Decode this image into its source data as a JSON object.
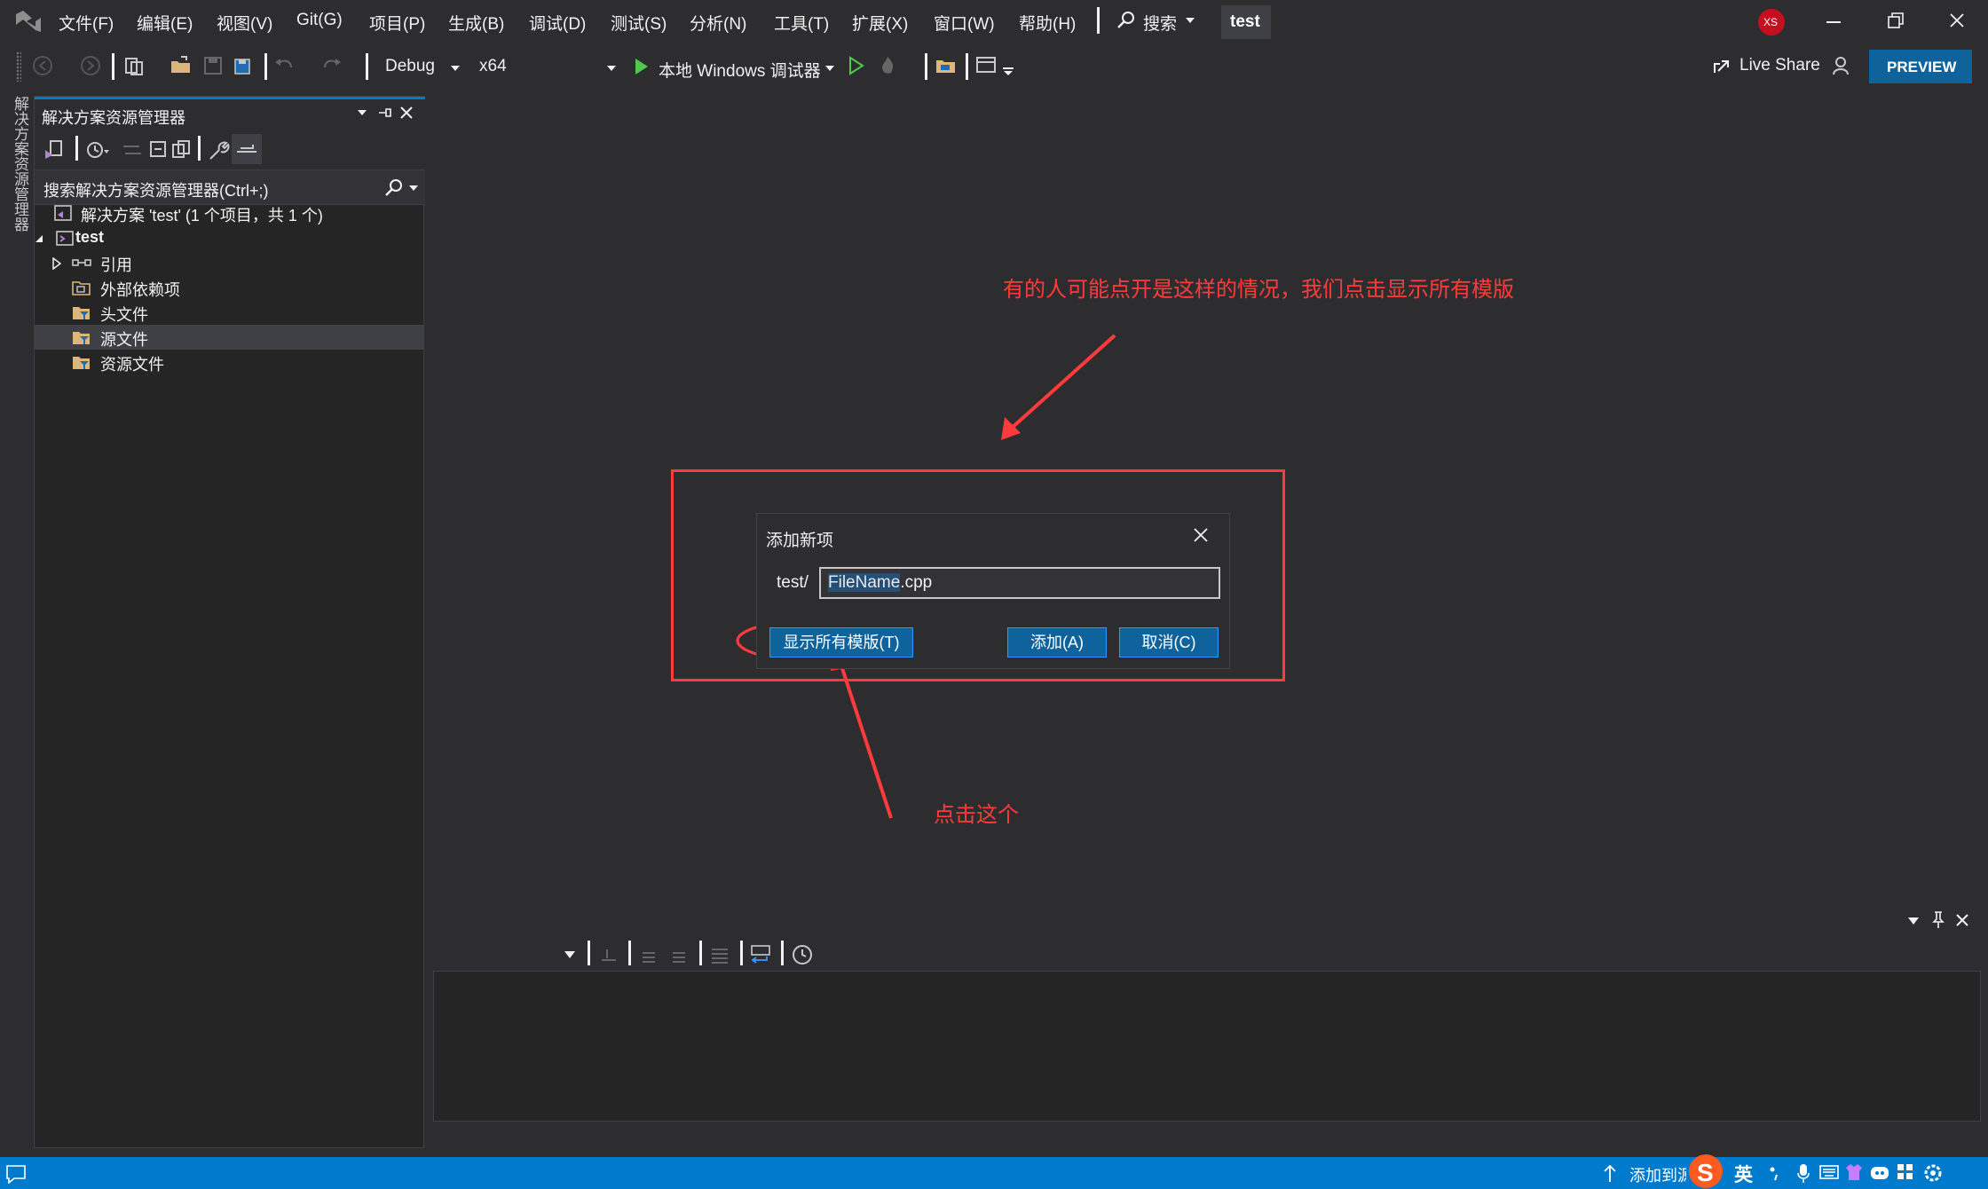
{
  "titlebar": {
    "menus": [
      "文件(F)",
      "编辑(E)",
      "视图(V)",
      "Git(G)",
      "项目(P)",
      "生成(B)",
      "调试(D)",
      "测试(S)",
      "分析(N)",
      "工具(T)",
      "扩展(X)",
      "窗口(W)",
      "帮助(H)"
    ],
    "search_label": "搜索",
    "project_badge": "test",
    "avatar_initials": "XS"
  },
  "toolbar": {
    "configuration": "Debug",
    "platform": "x64",
    "debugger_label": "本地 Windows 调试器",
    "live_share": "Live Share",
    "preview": "PREVIEW"
  },
  "side_strip": {
    "label": "解决方案资源管理器"
  },
  "solution_explorer": {
    "title": "解决方案资源管理器",
    "search_placeholder": "搜索解决方案资源管理器(Ctrl+;)",
    "items": [
      {
        "label": "解决方案 'test' (1 个项目，共 1 个)"
      },
      {
        "label": "test"
      },
      {
        "label": "引用"
      },
      {
        "label": "外部依赖项"
      },
      {
        "label": "头文件"
      },
      {
        "label": "源文件"
      },
      {
        "label": "资源文件"
      }
    ]
  },
  "dialog": {
    "title": "添加新项",
    "path_prefix": "test/",
    "filename_selected": "FileName",
    "filename_ext": ".cpp",
    "show_all_templates": "显示所有模版(T)",
    "add": "添加(A)",
    "cancel": "取消(C)"
  },
  "annotations": {
    "top_note": "有的人可能点开是这样的情况，我们点击显示所有模版",
    "bottom_note": "点击这个"
  },
  "statusbar": {
    "add_to_source": "添加到源",
    "ime_lang": "英"
  },
  "colors": {
    "accent": "#007acc",
    "annotation": "#ff3b3b",
    "avatar": "#c50f1f"
  }
}
